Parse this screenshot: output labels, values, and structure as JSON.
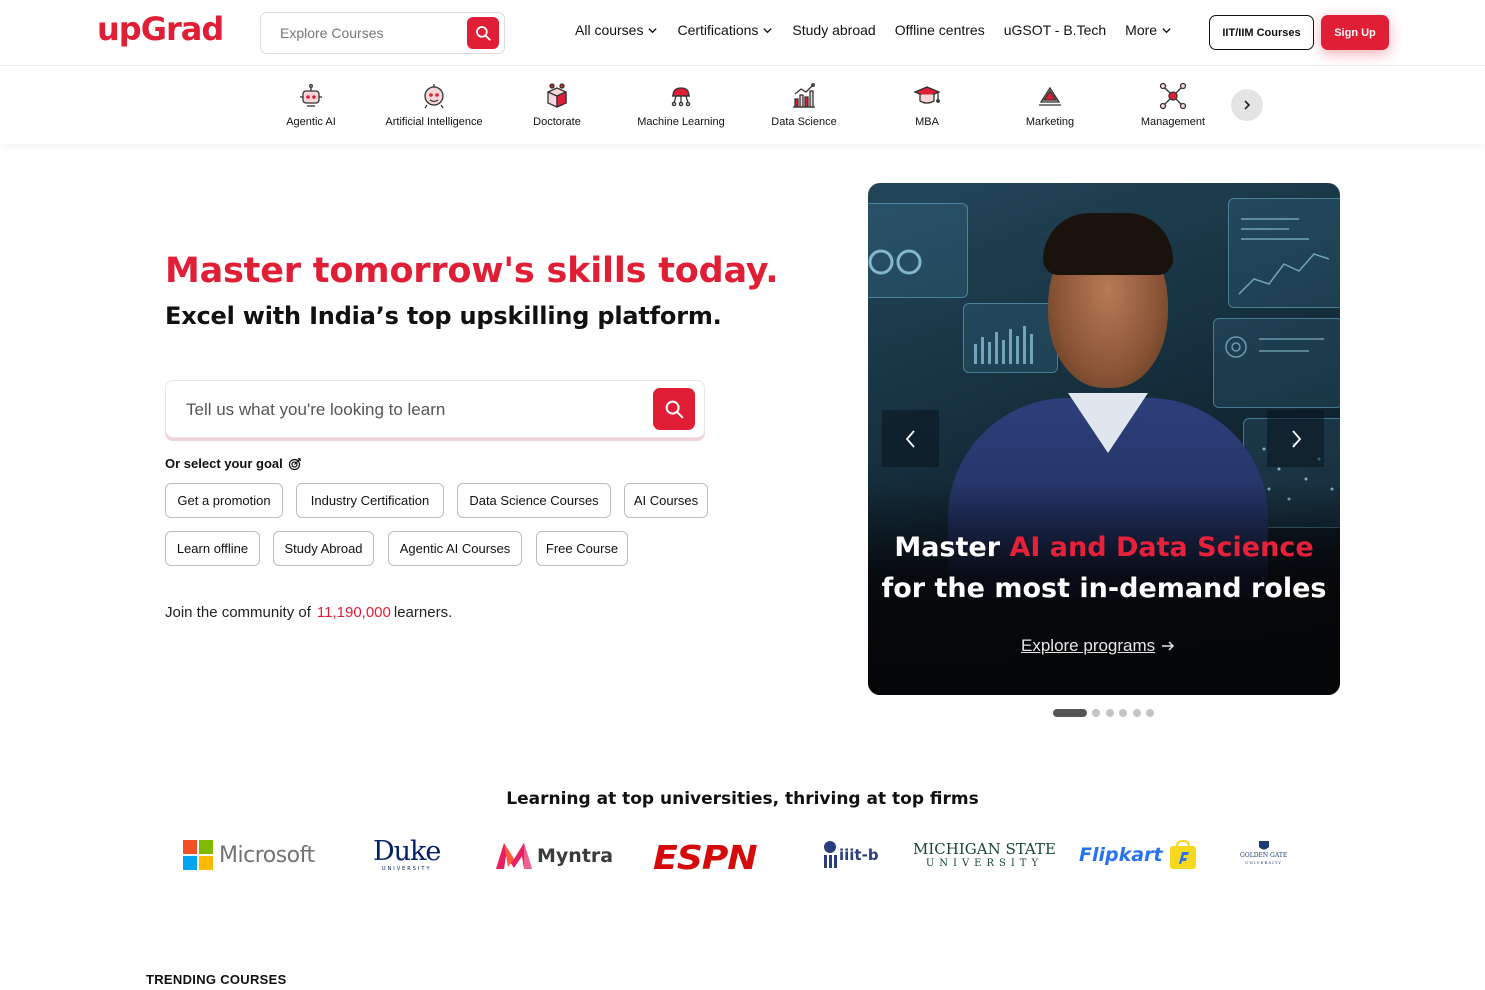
{
  "header": {
    "logo_text": "upGrad",
    "search_placeholder": "Explore Courses",
    "nav": [
      {
        "label": "All courses",
        "has_dropdown": true
      },
      {
        "label": "Certifications",
        "has_dropdown": true
      },
      {
        "label": "Study abroad",
        "has_dropdown": false
      },
      {
        "label": "Offline centres",
        "has_dropdown": false
      },
      {
        "label": "uGSOT - B.Tech",
        "has_dropdown": false
      },
      {
        "label": "More",
        "has_dropdown": true
      }
    ],
    "iit_button": "IIT/IIM Courses",
    "signup_button": "Sign Up"
  },
  "categories": [
    {
      "label": "Agentic AI",
      "icon": "robot-icon"
    },
    {
      "label": "Artificial Intelligence",
      "icon": "ai-head-icon"
    },
    {
      "label": "Doctorate",
      "icon": "doctorate-cube-icon"
    },
    {
      "label": "Machine Learning",
      "icon": "brain-network-icon"
    },
    {
      "label": "Data Science",
      "icon": "bar-chart-icon"
    },
    {
      "label": "MBA",
      "icon": "graduation-cap-icon"
    },
    {
      "label": "Marketing",
      "icon": "megaphone-icon"
    },
    {
      "label": "Management",
      "icon": "network-nodes-icon"
    }
  ],
  "hero": {
    "title": "Master tomorrow's skills today.",
    "subtitle": "Excel with India’s top upskilling platform.",
    "search_placeholder": "Tell us what you're looking to learn",
    "goal_label": "Or select your goal",
    "goals_row1": [
      "Get a promotion",
      "Industry Certification",
      "Data Science Courses",
      "AI Courses"
    ],
    "goals_row2": [
      "Learn offline",
      "Study Abroad",
      "Agentic AI Courses",
      "Free Course"
    ],
    "community_prefix": "Join the community of",
    "community_count": "11,190,000",
    "community_suffix": "learners."
  },
  "carousel": {
    "line1_prefix": "Master",
    "line1_highlight": "AI and Data Science",
    "line2": "for the most in-demand roles",
    "cta": "Explore programs",
    "slide_count": 6,
    "active_slide": 1
  },
  "partners": {
    "title": "Learning at top universities, thriving at top firms",
    "logos": [
      "Microsoft",
      "Duke",
      "UNIVERSITY",
      "Myntra",
      "ESPN",
      "iiit-b",
      "MICHIGAN STATE",
      "UNIVERSITY",
      "Flipkart",
      "GOLDEN GATE",
      "UNIVERSITY"
    ]
  },
  "trending_title": "TRENDING COURSES",
  "colors": {
    "brand": "#e01e36",
    "text": "#111111"
  }
}
